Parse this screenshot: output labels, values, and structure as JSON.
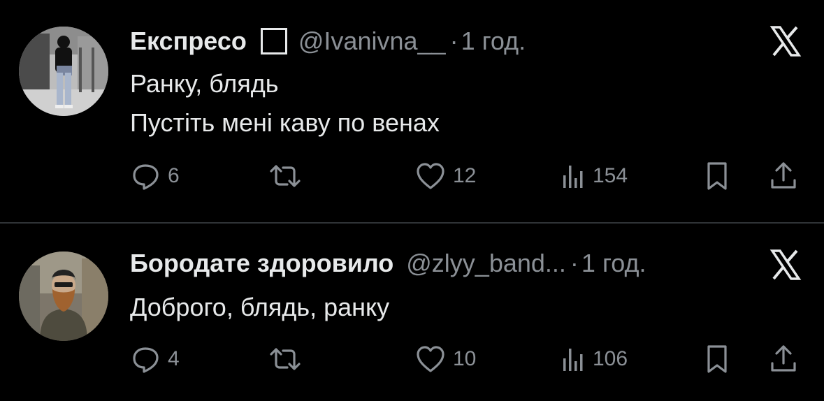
{
  "tweets": [
    {
      "author_name": "Експресо",
      "handle": "@Ivanivna__",
      "dot": "·",
      "time": "1 год.",
      "text_lines": [
        "Ранку, блядь",
        "Пустіть мені каву по венах"
      ],
      "replies": "6",
      "retweets": "",
      "likes": "12",
      "views": "154"
    },
    {
      "author_name": "Бородате здоровило",
      "handle": "@zlyy_band...",
      "dot": "·",
      "time": "1 год.",
      "text_lines": [
        "Доброго, блядь, ранку"
      ],
      "replies": "4",
      "retweets": "",
      "likes": "10",
      "views": "106"
    }
  ],
  "icons": {
    "reply": "speech-bubble-icon",
    "retweet": "repost-arrows-icon",
    "like": "heart-icon",
    "views": "bar-chart-icon",
    "bookmark": "bookmark-icon",
    "share": "share-upload-icon",
    "logo": "x-logo-icon",
    "flag": "flag-box-icon"
  },
  "colors": {
    "background": "#000000",
    "primary_text": "#e7e9ea",
    "secondary_text": "#8b9096",
    "divider": "#2f3336"
  }
}
